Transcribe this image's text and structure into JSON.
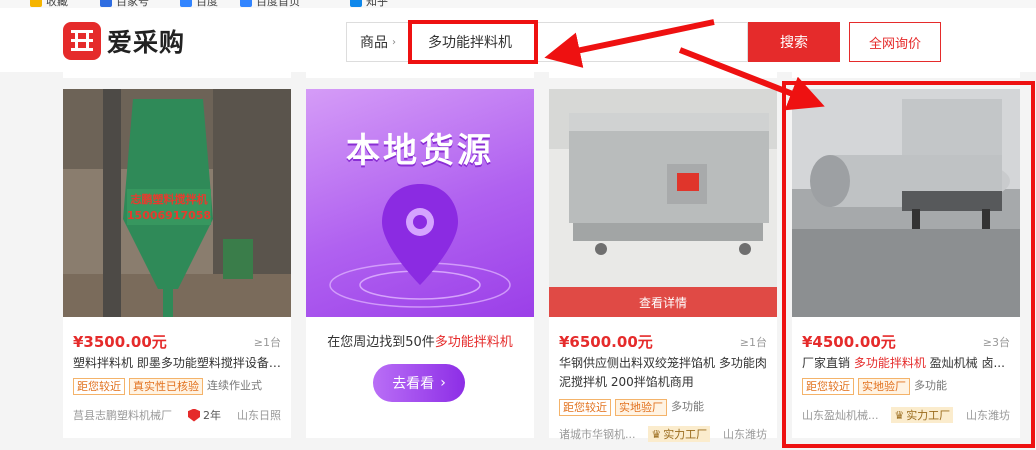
{
  "bookmarks": [
    "收藏",
    "百家号",
    "百度",
    "百度首页",
    "知乎"
  ],
  "header": {
    "logo_text": "爱采购",
    "search_type": "商品",
    "search_query": "多功能拌料机",
    "search_button": "搜索",
    "ask_button": "全网询价"
  },
  "cards": [
    {
      "price": "¥3500.00元",
      "moq": "≥1台",
      "title": "塑料拌料机 即墨多功能塑料搅拌设备 ...",
      "tags": [
        "距您较近",
        "真实性已核验",
        "连续作业式"
      ],
      "company": "莒县志鹏塑料机械厂",
      "years": "2年",
      "location": "山东日照",
      "img_text": [
        "志鹏塑料搅拌机",
        "15006917058"
      ]
    },
    {
      "price": "¥6500.00元",
      "moq": "≥1台",
      "title": "华钢供应侧出料双绞笼拌馅机 多功能肉泥搅拌机 200拌馅机商用",
      "tags": [
        "距您较近",
        "实地验厂",
        "多功能"
      ],
      "company": "诸城市华钢机...",
      "badge": "实力工厂",
      "location": "山东潍坊",
      "detail": "查看详情"
    },
    {
      "price": "¥4500.00元",
      "moq": "≥3台",
      "title_pre": "厂家直销 ",
      "title_hl": "多功能拌料机",
      "title_post": " 盈灿机械 卤...",
      "tags": [
        "距您较近",
        "实地验厂",
        "多功能"
      ],
      "company": "山东盈灿机械...",
      "badge": "实力工厂",
      "location": "山东潍坊"
    }
  ],
  "promo": {
    "title": "本地货源",
    "text_pre": "在您周边找到50件",
    "text_hl": "多功能拌料机",
    "button": "去看看"
  },
  "colors": {
    "brand_red": "#e52b2b",
    "annotation_red": "#ee1111",
    "promo_purple": "#9b3fe8"
  }
}
